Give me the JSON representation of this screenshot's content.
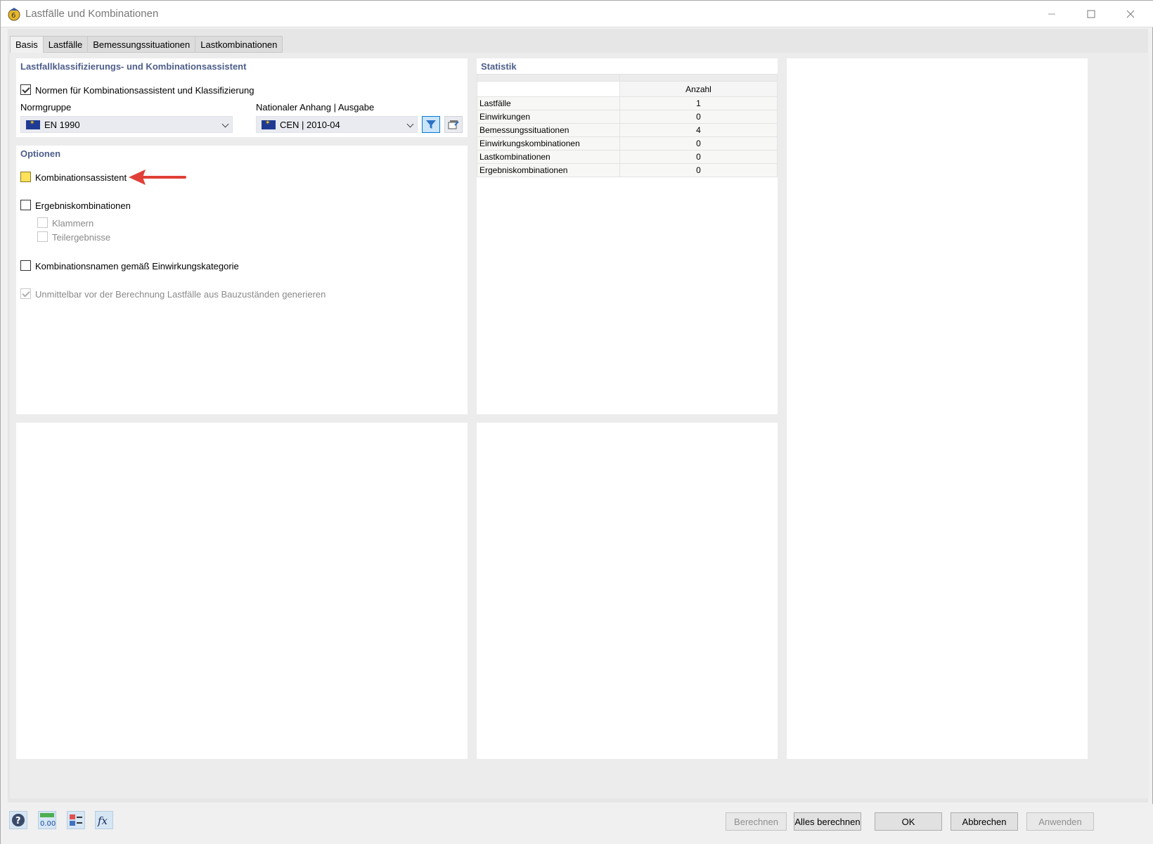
{
  "window": {
    "title": "Lastfälle und Kombinationen"
  },
  "tabs": [
    {
      "label": "Basis",
      "active": true
    },
    {
      "label": "Lastfälle"
    },
    {
      "label": "Bemessungssituationen"
    },
    {
      "label": "Lastkombinationen"
    }
  ],
  "assistant": {
    "title": "Lastfallklassifizierungs- und Kombinationsassistent",
    "norms_checkbox_label": "Normen für Kombinationsassistent und Klassifizierung",
    "norms_checked": true,
    "normgruppe_label": "Normgruppe",
    "normgruppe_value": "EN 1990",
    "national_label": "Nationaler Anhang | Ausgabe",
    "national_value": "CEN | 2010-04"
  },
  "options": {
    "title": "Optionen",
    "kombinationsassistent": "Kombinationsassistent",
    "ergebniskombinationen": "Ergebniskombinationen",
    "klammern": "Klammern",
    "teilergebnisse": "Teilergebnisse",
    "kombinationsnamen": "Kombinationsnamen gemäß Einwirkungskategorie",
    "unmittelbar": "Unmittelbar vor der Berechnung Lastfälle aus Bauzuständen generieren"
  },
  "statistik": {
    "title": "Statistik",
    "column": "Anzahl",
    "rows": [
      {
        "name": "Lastfälle",
        "value": "1"
      },
      {
        "name": "Einwirkungen",
        "value": "0"
      },
      {
        "name": "Bemessungssituationen",
        "value": "4"
      },
      {
        "name": "Einwirkungskombinationen",
        "value": "0"
      },
      {
        "name": "Lastkombinationen",
        "value": "0"
      },
      {
        "name": "Ergebniskombinationen",
        "value": "0"
      }
    ]
  },
  "buttons": {
    "berechnen": "Berechnen",
    "alles_berechnen": "Alles berechnen",
    "ok": "OK",
    "abbrechen": "Abbrechen",
    "anwenden": "Anwenden"
  },
  "colors": {
    "panel_title": "#4d5e8a",
    "highlight_checkbox": "#ffe15a",
    "arrow": "#e04038"
  }
}
